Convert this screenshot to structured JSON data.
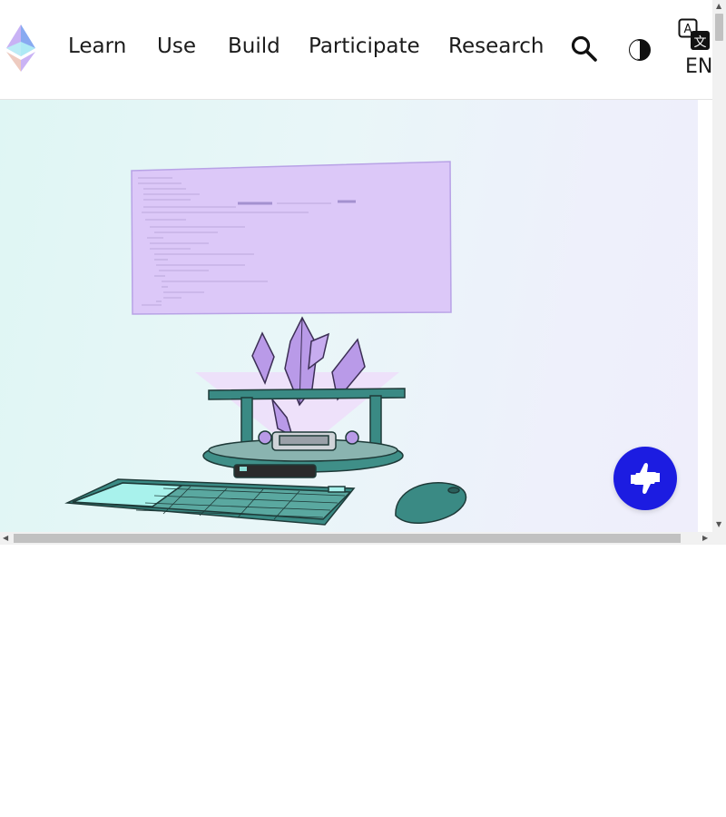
{
  "nav": {
    "links": [
      {
        "label": "Learn"
      },
      {
        "label": "Use"
      },
      {
        "label": "Build"
      },
      {
        "label": "Participate"
      },
      {
        "label": "Research"
      }
    ],
    "search_icon": "search-icon",
    "theme_icon": "half-moon-theme-icon",
    "language": {
      "icon": "translate-icon",
      "code": "EN"
    }
  },
  "hero": {
    "illustration": "developer-workstation-with-crystals"
  },
  "feedback": {
    "icon": "thumbs-up-down-icon"
  },
  "colors": {
    "brand": "#1c1ce1",
    "text": "#1b1b1b",
    "screen": "#dcc8f8",
    "teal": "#2f7d78",
    "crystal": "#b99ae8"
  }
}
